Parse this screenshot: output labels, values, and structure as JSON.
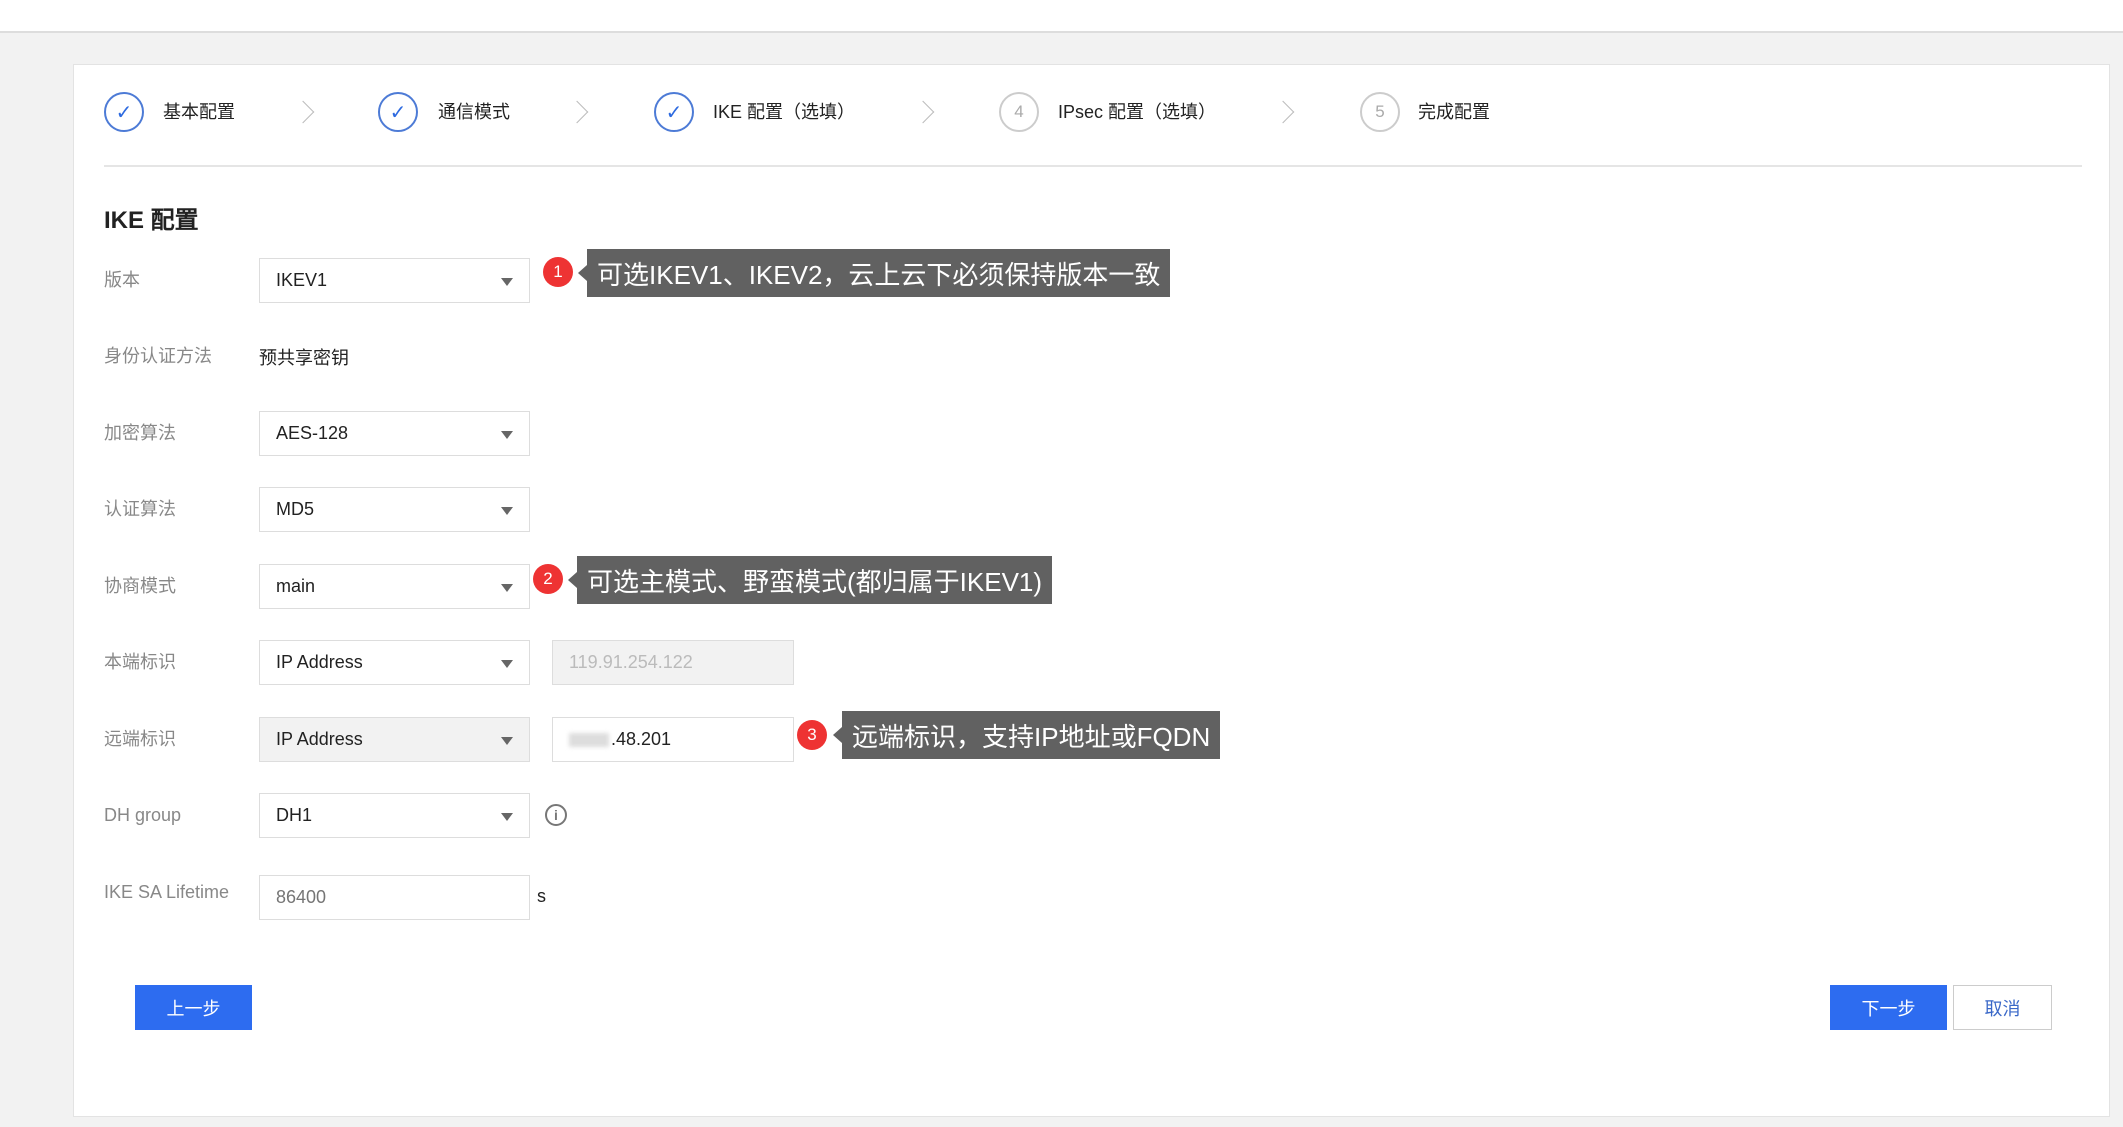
{
  "steps": [
    {
      "label": "基本配置",
      "status": "done",
      "icon": "check-icon"
    },
    {
      "label": "通信模式",
      "status": "done",
      "icon": "check-icon"
    },
    {
      "label": "IKE 配置（选填）",
      "status": "done",
      "icon": "check-icon"
    },
    {
      "label": "IPsec 配置（选填）",
      "status": "todo",
      "number": "4"
    },
    {
      "label": "完成配置",
      "status": "todo",
      "number": "5"
    }
  ],
  "section_title": "IKE 配置",
  "fields": {
    "version": {
      "label": "版本",
      "value": "IKEV1"
    },
    "auth_method": {
      "label": "身份认证方法",
      "value": "预共享密钥"
    },
    "encryption": {
      "label": "加密算法",
      "value": "AES-128"
    },
    "auth_algorithm": {
      "label": "认证算法",
      "value": "MD5"
    },
    "negotiation": {
      "label": "协商模式",
      "value": "main"
    },
    "local_id": {
      "label": "本端标识",
      "type": "IP Address",
      "value": "119.91.254.122"
    },
    "remote_id": {
      "label": "远端标识",
      "type": "IP Address",
      "value": ".48.201"
    },
    "dh_group": {
      "label": "DH group",
      "value": "DH1"
    },
    "lifetime": {
      "label": "IKE SA Lifetime",
      "placeholder": "86400",
      "unit": "s"
    }
  },
  "annotations": [
    {
      "number": "1",
      "text": "可选IKEV1、IKEV2，云上云下必须保持版本一致"
    },
    {
      "number": "2",
      "text": "可选主模式、野蛮模式(都归属于IKEV1)"
    },
    {
      "number": "3",
      "text": "远端标识，支持IP地址或FQDN"
    }
  ],
  "buttons": {
    "prev": "上一步",
    "next": "下一步",
    "cancel": "取消"
  },
  "colors": {
    "primary": "#2d6cf0",
    "badge": "#e33333",
    "tooltip": "#616161"
  }
}
